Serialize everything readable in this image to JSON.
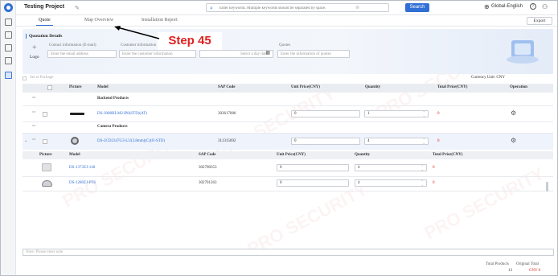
{
  "topbar": {
    "project_title": "Testing Project",
    "search_placeholder": "Enter keywords. Multiple keywords should be separated by space.",
    "search_label": "Search",
    "language_label": "Global-English"
  },
  "tabs": [
    {
      "label": "Quote",
      "active": true
    },
    {
      "label": "Map Overview",
      "active": false
    },
    {
      "label": "Installation Report",
      "active": false
    }
  ],
  "toolbar": {
    "export_label": "Export"
  },
  "quotation": {
    "section_title": "Quotation Details",
    "logo_label": "Logo",
    "contact_label": "Contact information (E-mail)",
    "contact_placeholder": "Enter the email address",
    "customer_label": "Customer information",
    "customer_placeholder": "Enter the customer information",
    "date_placeholder": "Select a day date.",
    "quotes_label": "Quotes",
    "quotes_placeholder": "Enter the information of quotes"
  },
  "overlay": {
    "step_label": "Step 45"
  },
  "package": {
    "label": "Set to Package",
    "currency_label": "Currency Unit:  CNY"
  },
  "table": {
    "headers": {
      "picture": "Picture",
      "model": "Model",
      "sap": "SAP Code",
      "unit_price": "Unit Price(CNY)",
      "quantity": "Quantity",
      "total_price": "Total Price(CNY)",
      "operation": "Operation"
    },
    "groups": [
      {
        "name": "Backend Products"
      },
      {
        "name": "Camera Products"
      }
    ],
    "rows": [
      {
        "model": "DS-3008HI-M21P8(STD)(AT)",
        "sap": "303617006",
        "unit_price": "0",
        "quantity": "1",
        "total": "0"
      },
      {
        "model": "DS-2CD2347G3-LU(3.8mm)(C)(O-STD)",
        "sap": "311315692",
        "unit_price": "0",
        "quantity": "4",
        "total": "0"
      }
    ]
  },
  "subtable": {
    "headers": {
      "picture": "Picture",
      "model": "Model",
      "sap": "SAP Code",
      "unit_price": "Unit Price(CNY)",
      "quantity": "Quantity",
      "total_price": "Total Price(CNY)"
    },
    "rows": [
      {
        "model": "DS-1373ZJ-140",
        "sap": "302700353",
        "unit_price": "0",
        "quantity": "4",
        "total": "0"
      },
      {
        "model": "DS-1280ZJ-PT6",
        "sap": "302701263",
        "unit_price": "0",
        "quantity": "4",
        "total": "0"
      }
    ]
  },
  "note": {
    "placeholder": "Note: Please enter note"
  },
  "totals": {
    "products_label": "Total Products",
    "products_value": "13",
    "original_label": "Original Total",
    "original_value": "CNY 0"
  },
  "watermark": "PRO SECURITY",
  "colors": {
    "accent": "#2f6fd6",
    "danger": "#e02020"
  }
}
